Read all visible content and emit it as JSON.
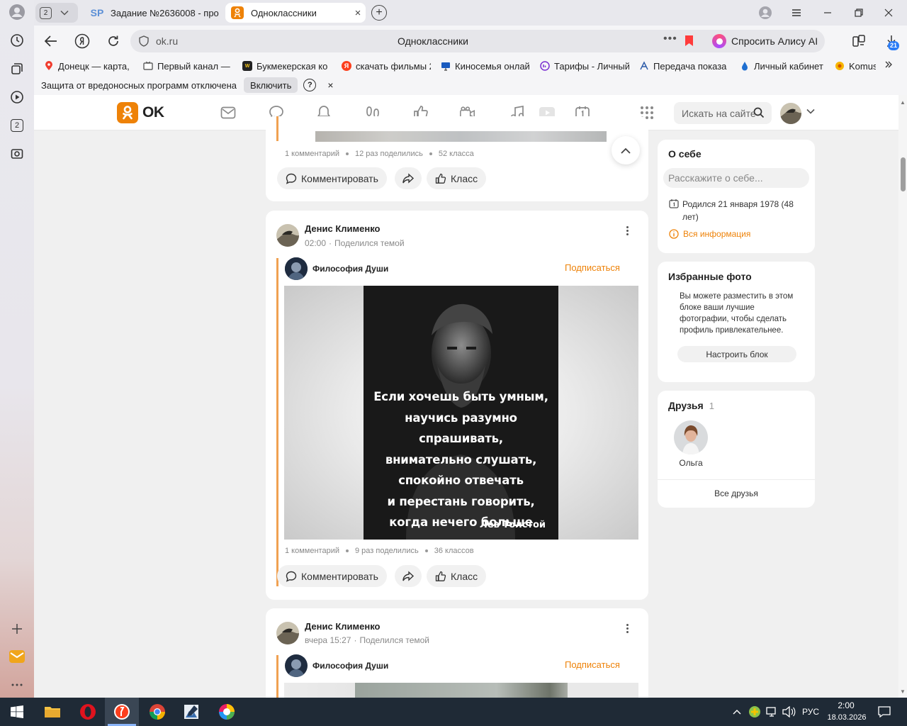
{
  "browser": {
    "tab_count": "2",
    "tabs": [
      {
        "icon": "SP",
        "title": "Задание №2636008 - про"
      },
      {
        "title": "Одноклассники"
      }
    ],
    "address": {
      "url": "ok.ru",
      "title": "Одноклассники"
    },
    "alisa_label": "Спросить Алису AI",
    "downloads_badge": "21",
    "bookmarks": [
      {
        "label": "Донецк — карта, "
      },
      {
        "label": "Первый канал — "
      },
      {
        "label": "Букмекерская ко"
      },
      {
        "label": "скачать фильмы 2"
      },
      {
        "label": "Киносемья онлай"
      },
      {
        "label": "Тарифы - Личный"
      },
      {
        "label": "Передача показа"
      },
      {
        "label": "Личный кабинет"
      },
      {
        "label": "Komus"
      }
    ],
    "protection": {
      "text": "Защита от вредоносных программ отключена",
      "button": "Включить",
      "help": "?",
      "close": "×"
    },
    "sidebar_badge": "2"
  },
  "ok": {
    "logo_text": "OK",
    "search_placeholder": "Искать на сайте"
  },
  "feed": {
    "top_post": {
      "meta": [
        "1 комментарий",
        "12 раз поделились",
        "52 класса"
      ],
      "comment_label": "Комментировать",
      "like_label": "Класс"
    },
    "posts": [
      {
        "author": "Денис Клименко",
        "time": "02:00",
        "action": "Поделился темой",
        "group": "Философия Души",
        "subscribe": "Подписаться",
        "image_text": [
          "Если хочешь быть умным,",
          "научись разумно спрашивать,",
          "внимательно слушать,",
          "спокойно отвечать",
          "и перестань говорить,",
          "когда нечего больше сказать."
        ],
        "image_signature": "Лев Толстой",
        "meta": [
          "1 комментарий",
          "9 раз поделились",
          "36 классов"
        ],
        "comment_label": "Комментировать",
        "like_label": "Класс"
      },
      {
        "author": "Денис Клименко",
        "time": "вчера 15:27",
        "action": "Поделился темой",
        "group": "Философия Души",
        "subscribe": "Подписаться"
      }
    ]
  },
  "right": {
    "about": {
      "title": "О себе",
      "placeholder": "Расскажите о себе...",
      "birthday": "Родился 21 января 1978 (48 лет)",
      "all_info": "Вся информация"
    },
    "photos": {
      "title": "Избранные фото",
      "text": "Вы можете разместить в этом блоке ваши лучшие фотографии, чтобы сделать профиль привлекательнее.",
      "button": "Настроить блок"
    },
    "friends": {
      "title": "Друзья",
      "count": "1",
      "items": [
        {
          "name": "Ольга"
        }
      ],
      "all_label": "Все друзья"
    }
  },
  "taskbar": {
    "lang": "РУС",
    "time": "2:00",
    "date": "18.03.2026"
  },
  "colors": {
    "ok_orange": "#ee8208",
    "taskbar": "#1f2a36"
  }
}
